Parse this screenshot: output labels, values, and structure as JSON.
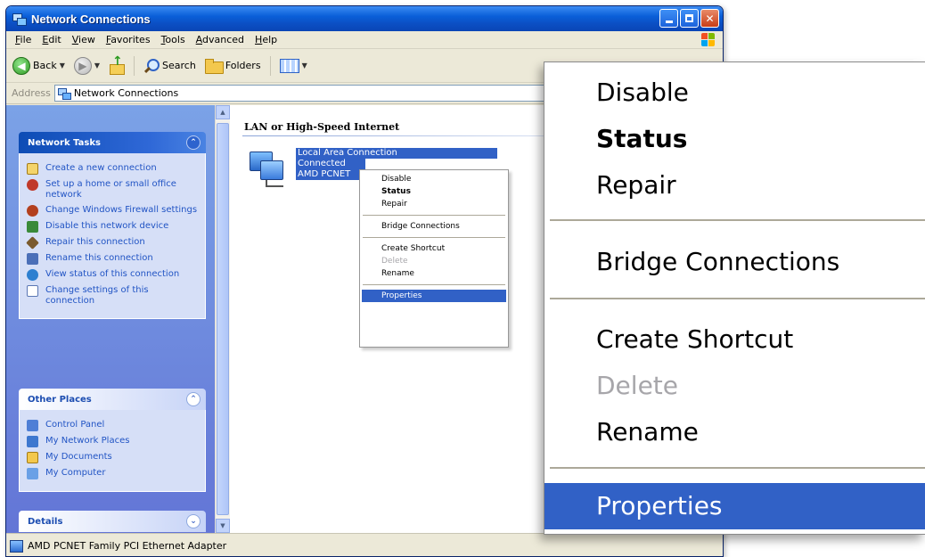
{
  "window": {
    "title": "Network Connections"
  },
  "menubar": {
    "items": [
      "File",
      "Edit",
      "View",
      "Favorites",
      "Tools",
      "Advanced",
      "Help"
    ]
  },
  "toolbar": {
    "back_label": "Back",
    "search_label": "Search",
    "folders_label": "Folders"
  },
  "address": {
    "label": "Address",
    "value": "Network Connections"
  },
  "network_tasks": {
    "title": "Network Tasks",
    "items": [
      "Create a new connection",
      "Set up a home or small office network",
      "Change Windows Firewall settings",
      "Disable this network device",
      "Repair this connection",
      "Rename this connection",
      "View status of this connection",
      "Change settings of this connection"
    ]
  },
  "other_places": {
    "title": "Other Places",
    "items": [
      "Control Panel",
      "My Network Places",
      "My Documents",
      "My Computer"
    ]
  },
  "details": {
    "title": "Details"
  },
  "content": {
    "group_title": "LAN or High-Speed Internet",
    "connection": {
      "name": "Local Area Connection",
      "status": "Connected",
      "device": "AMD PCNET"
    }
  },
  "context_menu": {
    "items": [
      "Disable",
      "Status",
      "Repair",
      "Bridge Connections",
      "Create Shortcut",
      "Delete",
      "Rename",
      "Properties"
    ],
    "default_item": "Status",
    "disabled_item": "Delete",
    "selected_item": "Properties"
  },
  "statusbar": {
    "text": "AMD PCNET Family PCI Ethernet Adapter"
  },
  "colors": {
    "titlebar": "#0a5fd8",
    "selection": "#3161c6",
    "taskpane": "#7ba2e7"
  }
}
